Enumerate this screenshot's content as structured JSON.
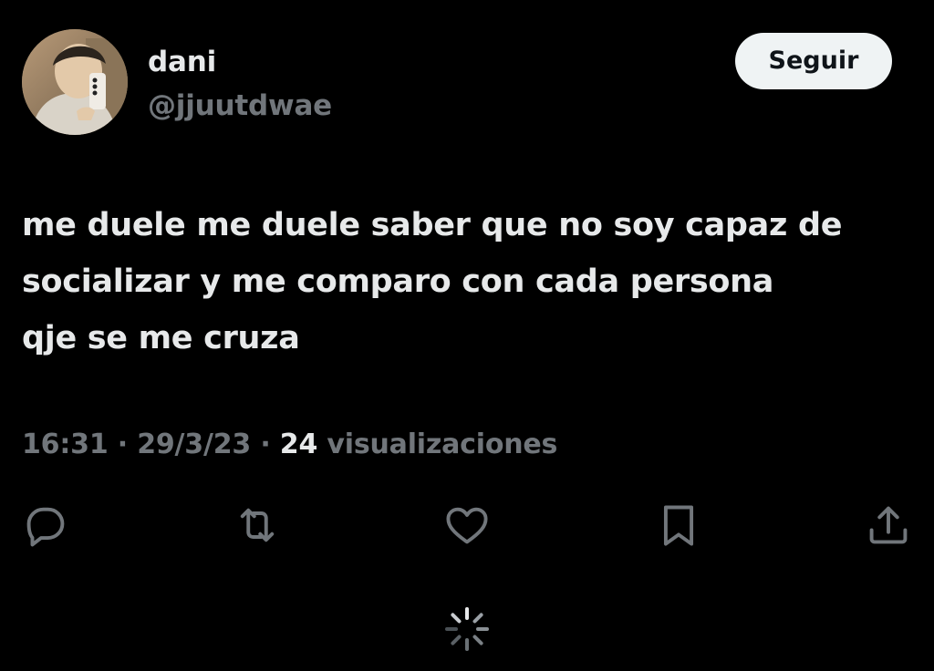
{
  "tweet": {
    "author": {
      "display_name": "dani",
      "handle": "@jjuutdwae"
    },
    "follow_label": "Seguir",
    "text_lines": [
      "me duele me duele saber que no soy capaz de",
      "socializar y me comparo con cada persona",
      "qje se me cruza"
    ],
    "time": "16:31",
    "date": "29/3/23",
    "separator": "·",
    "views_count": "24",
    "views_label": "visualizaciones"
  },
  "actions": [
    {
      "icon": "reply-icon"
    },
    {
      "icon": "retweet-icon"
    },
    {
      "icon": "like-icon"
    },
    {
      "icon": "bookmark-icon"
    },
    {
      "icon": "share-icon"
    }
  ],
  "loading": {
    "icon": "loading-spinner-icon"
  },
  "colors": {
    "background": "#000000",
    "primary_text": "#e7e9ea",
    "secondary_text": "#71767b",
    "follow_button_bg": "#eff3f4",
    "follow_button_text": "#0f1419"
  }
}
